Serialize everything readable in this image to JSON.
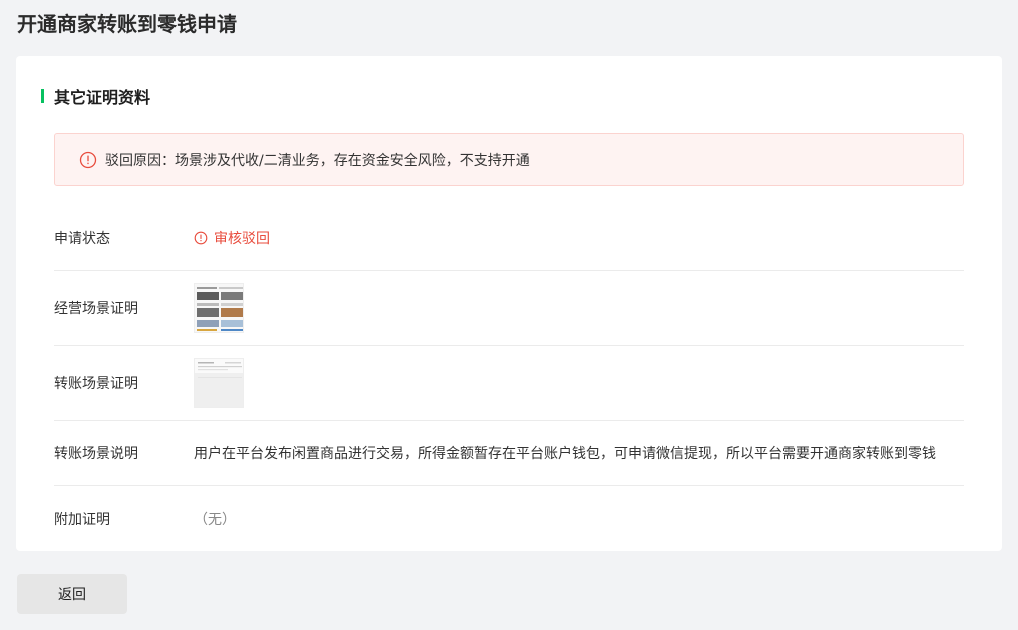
{
  "page": {
    "title": "开通商家转账到零钱申请"
  },
  "section": {
    "title": "其它证明资料"
  },
  "alert": {
    "icon": "warning-circle-icon",
    "text": "驳回原因：场景涉及代收/二清业务，存在资金安全风险，不支持开通"
  },
  "rows": {
    "status": {
      "label": "申请状态",
      "value": "审核驳回",
      "icon": "warning-circle-icon"
    },
    "business_proof": {
      "label": "经营场景证明"
    },
    "transfer_proof": {
      "label": "转账场景证明"
    },
    "transfer_desc": {
      "label": "转账场景说明",
      "value": "用户在平台发布闲置商品进行交易，所得金额暂存在平台账户钱包，可申请微信提现，所以平台需要开通商家转账到零钱"
    },
    "extra_proof": {
      "label": "附加证明",
      "value": "（无）"
    }
  },
  "actions": {
    "back_label": "返回"
  },
  "colors": {
    "accent": "#07c160",
    "error": "#e84c3d",
    "alert_bg": "#fef3f2"
  }
}
